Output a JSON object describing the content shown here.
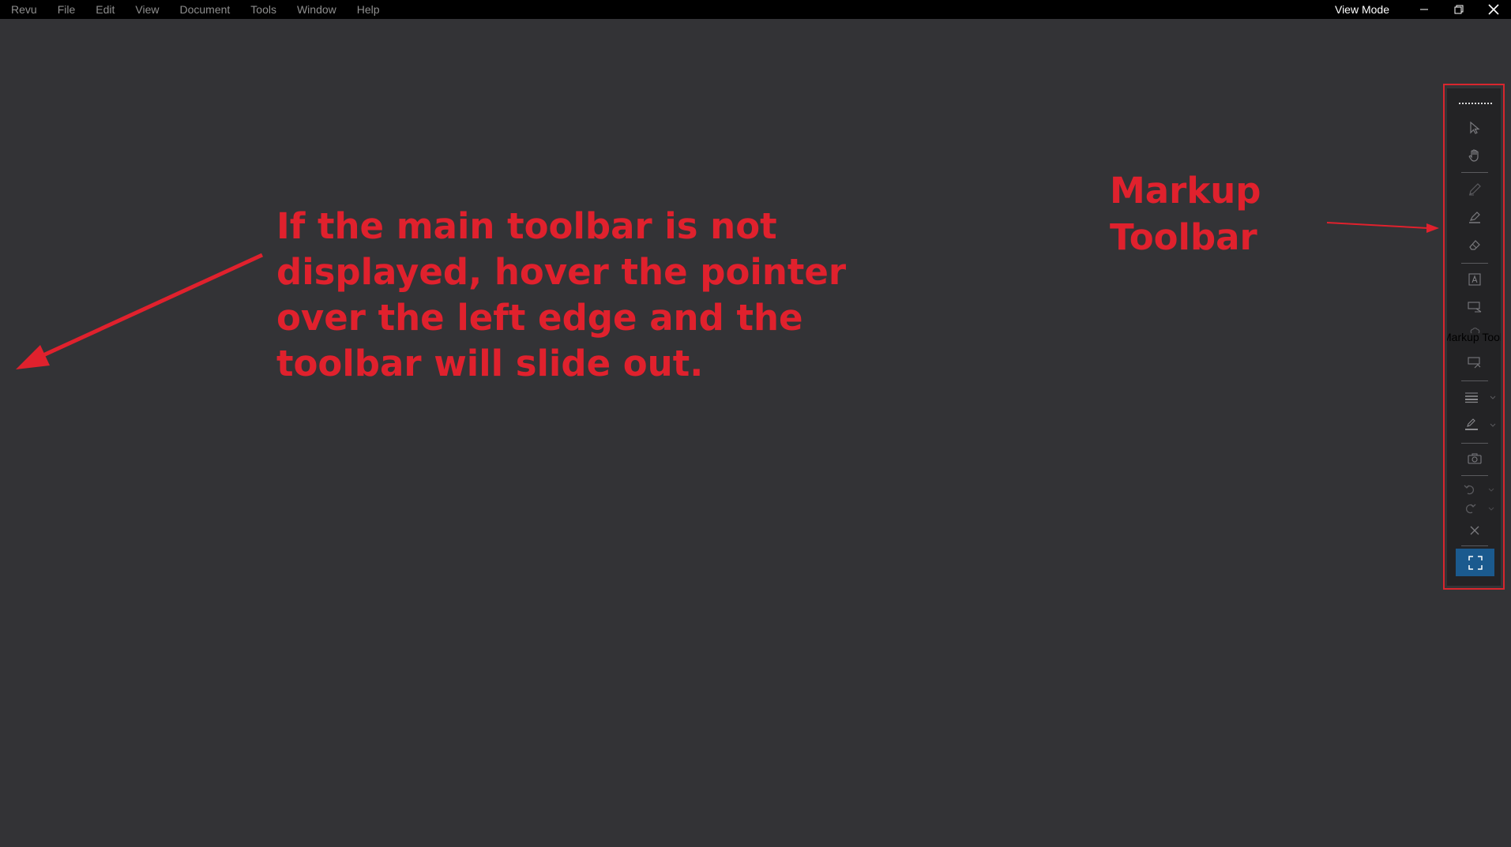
{
  "menubar": {
    "items": [
      "Revu",
      "File",
      "Edit",
      "View",
      "Document",
      "Tools",
      "Window",
      "Help"
    ],
    "view_mode": "View Mode"
  },
  "annotation": {
    "main_lines": [
      "If the main toolbar is not",
      "displayed, hover the pointer",
      "over the left edge and the",
      "toolbar will slide out."
    ],
    "toolbar_label_lines": [
      "Markup",
      "Toolbar"
    ],
    "color": "#e0212d"
  },
  "markup_toolbar": {
    "tooltip_label": "Markup Tool",
    "icons": [
      "select-icon",
      "pan-hand-icon",
      "pen-icon",
      "highlighter-icon",
      "eraser-icon",
      "text-box-icon",
      "callout-icon",
      "cloud-icon",
      "note-icon",
      "line-weight-icon",
      "line-color-icon",
      "snapshot-icon",
      "undo-icon",
      "redo-icon",
      "delete-icon",
      "fullscreen-icon"
    ],
    "accent": "#1b5a8e"
  },
  "colors": {
    "background": "#333336",
    "menubar": "#000000",
    "annotation_red": "#e0212d"
  }
}
